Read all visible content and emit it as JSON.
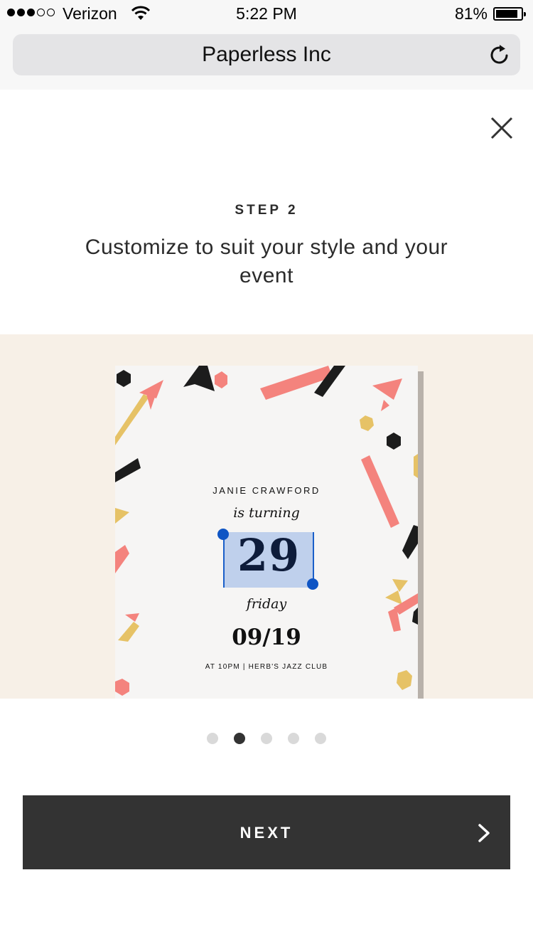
{
  "status_bar": {
    "carrier": "Verizon",
    "time": "5:22 PM",
    "battery_percent": "81%",
    "battery_level": 0.81,
    "signal_bars_filled": 3,
    "signal_bars_total": 5
  },
  "browser": {
    "page_title": "Paperless Inc",
    "reload_icon": "reload-icon"
  },
  "modal": {
    "close_icon": "close-icon",
    "step_label": "STEP 2",
    "title": "Customize to suit your style and your event"
  },
  "card": {
    "name": "JANIE CRAWFORD",
    "turning": "is turning",
    "age": "29",
    "day": "friday",
    "date": "09/19",
    "venue": "AT 10PM | HERB'S JAZZ CLUB",
    "selection_color": "#bfd0ec",
    "handle_color": "#0f55c4"
  },
  "pager": {
    "total": 5,
    "active_index": 1
  },
  "footer": {
    "next_label": "NEXT",
    "next_icon": "chevron-right-icon"
  },
  "colors": {
    "preview_background": "#f7f0e7",
    "button_background": "#333333",
    "confetti_pink": "#f4837d",
    "confetti_gold": "#e6c266",
    "confetti_black": "#1c1c1c"
  }
}
